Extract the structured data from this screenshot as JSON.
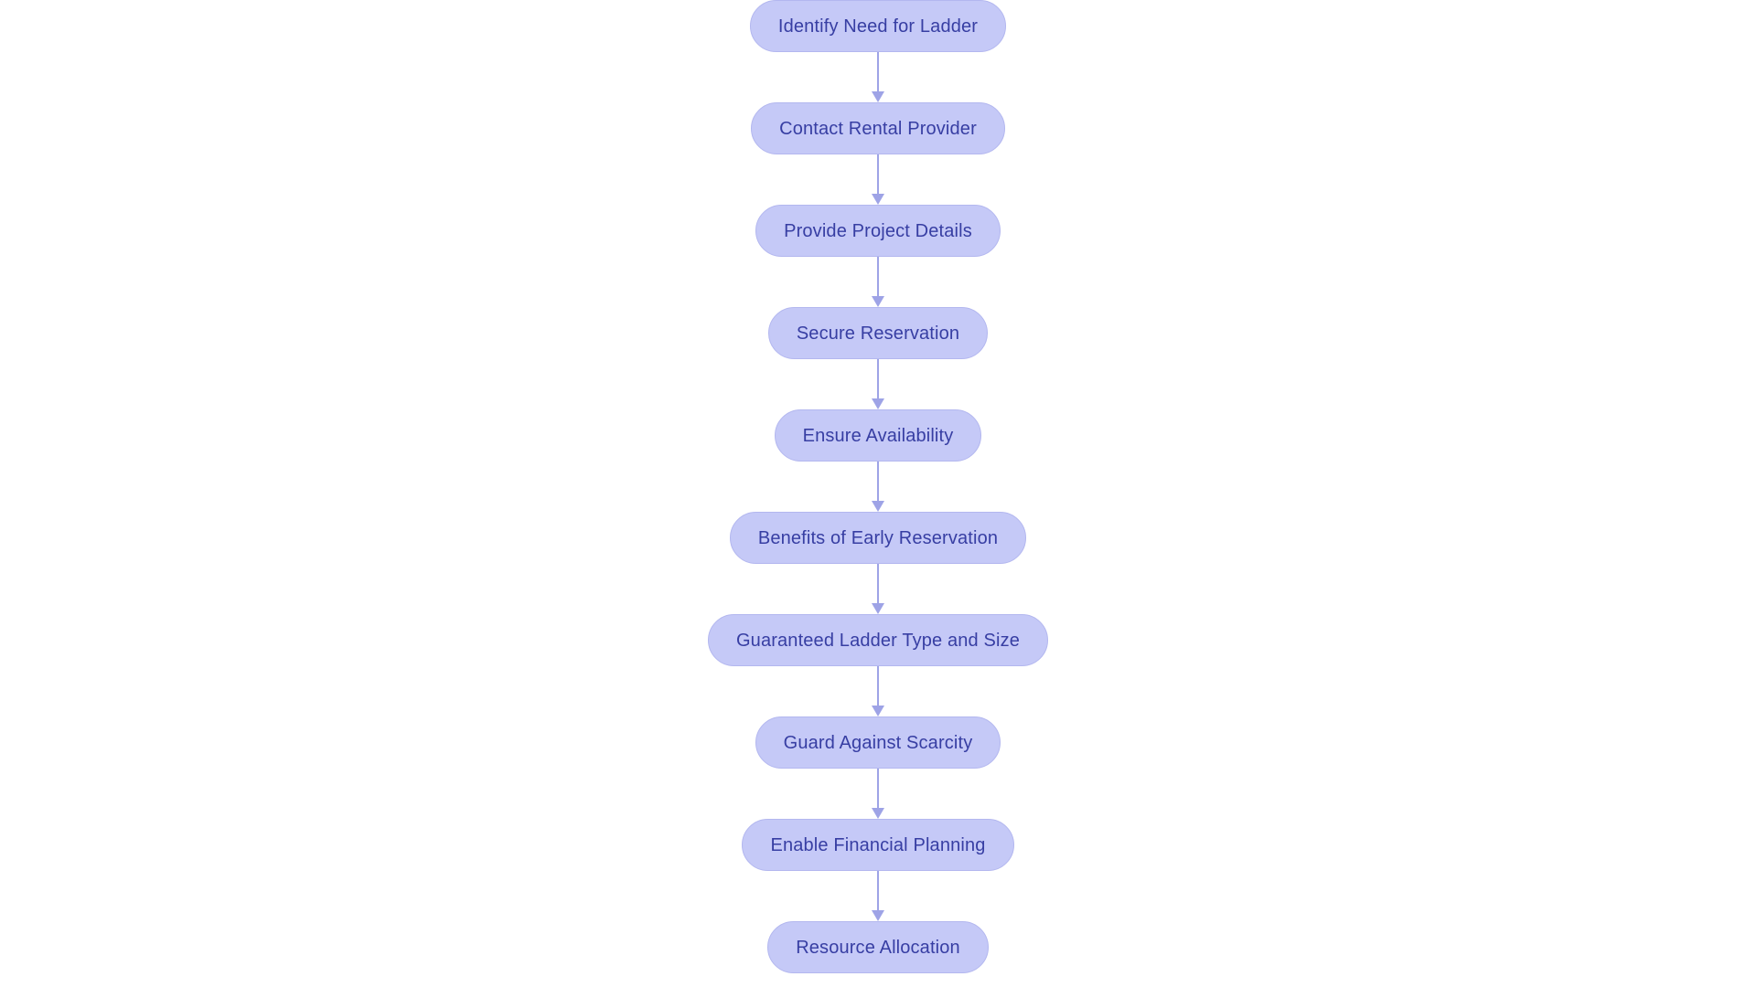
{
  "diagram": {
    "type": "flowchart",
    "orientation": "vertical-top-to-bottom",
    "background_color": "#ffffff",
    "node_fill_color": "#c5c9f7",
    "node_border_color": "#b3b7ef",
    "node_text_color": "#373ea3",
    "connector_color": "#9ea3e6",
    "node_shape": "stadium",
    "nodes": [
      {
        "id": "n1",
        "label": "Identify Need for Ladder"
      },
      {
        "id": "n2",
        "label": "Contact Rental Provider"
      },
      {
        "id": "n3",
        "label": "Provide Project Details"
      },
      {
        "id": "n4",
        "label": "Secure Reservation"
      },
      {
        "id": "n5",
        "label": "Ensure Availability"
      },
      {
        "id": "n6",
        "label": "Benefits of Early Reservation"
      },
      {
        "id": "n7",
        "label": "Guaranteed Ladder Type and Size"
      },
      {
        "id": "n8",
        "label": "Guard Against Scarcity"
      },
      {
        "id": "n9",
        "label": "Enable Financial Planning"
      },
      {
        "id": "n10",
        "label": "Resource Allocation"
      }
    ],
    "edges": [
      {
        "from": "n1",
        "to": "n2",
        "arrow": "down-arrow-icon"
      },
      {
        "from": "n2",
        "to": "n3",
        "arrow": "down-arrow-icon"
      },
      {
        "from": "n3",
        "to": "n4",
        "arrow": "down-arrow-icon"
      },
      {
        "from": "n4",
        "to": "n5",
        "arrow": "down-arrow-icon"
      },
      {
        "from": "n5",
        "to": "n6",
        "arrow": "down-arrow-icon"
      },
      {
        "from": "n6",
        "to": "n7",
        "arrow": "down-arrow-icon"
      },
      {
        "from": "n7",
        "to": "n8",
        "arrow": "down-arrow-icon"
      },
      {
        "from": "n8",
        "to": "n9",
        "arrow": "down-arrow-icon"
      },
      {
        "from": "n9",
        "to": "n10",
        "arrow": "down-arrow-icon"
      }
    ]
  }
}
